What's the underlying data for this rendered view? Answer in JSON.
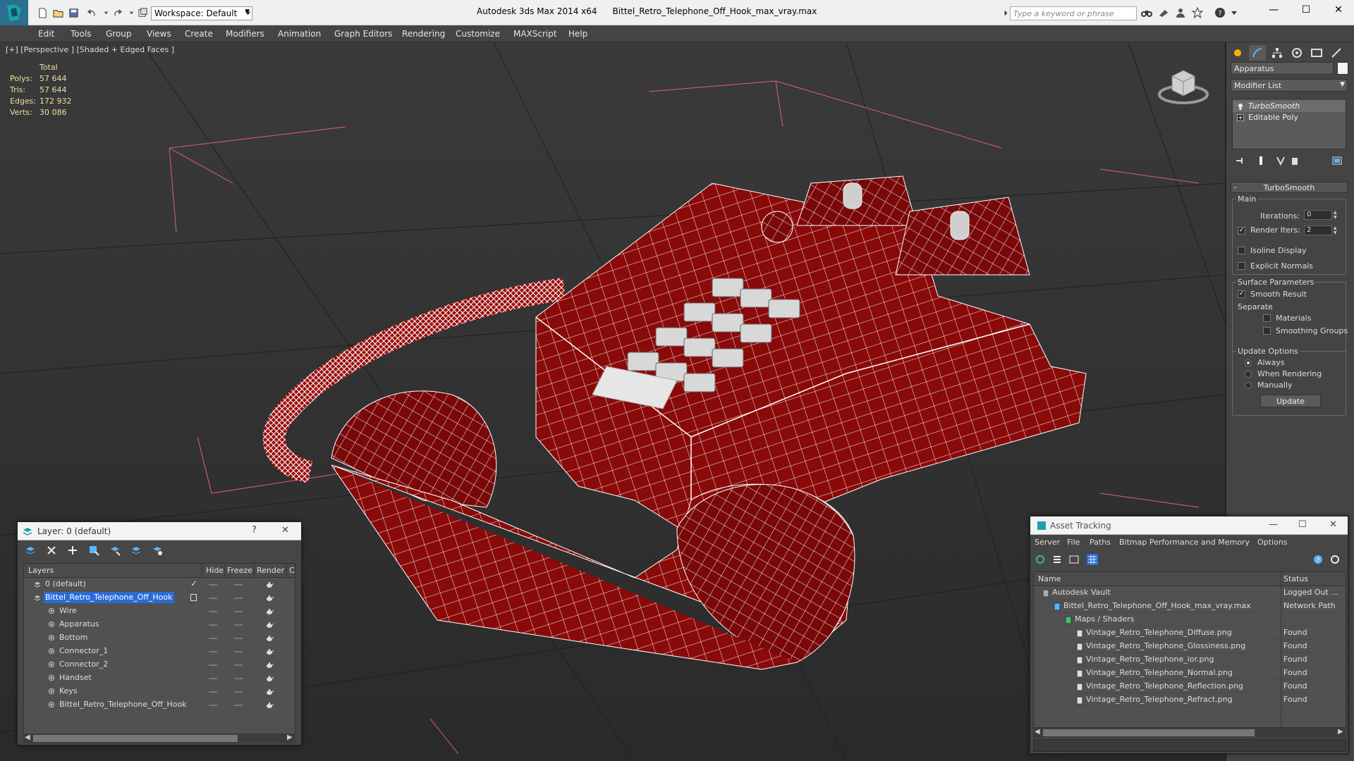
{
  "titlebar": {
    "workspace": "Workspace: Default",
    "app_name": "Autodesk 3ds Max  2014 x64",
    "file_name": "Bittel_Retro_Telephone_Off_Hook_max_vray.max",
    "search_placeholder": "Type a keyword or phrase"
  },
  "menu": [
    "Edit",
    "Tools",
    "Group",
    "Views",
    "Create",
    "Modifiers",
    "Animation",
    "Graph Editors",
    "Rendering",
    "Customize",
    "MAXScript",
    "Help"
  ],
  "viewport": {
    "label": "[+] [Perspective ] [Shaded + Edged Faces ]",
    "stats": {
      "header": "Total",
      "rows": [
        {
          "label": "Polys:",
          "value": "57 644"
        },
        {
          "label": "Tris:",
          "value": "57 644"
        },
        {
          "label": "Edges:",
          "value": "172 932"
        },
        {
          "label": "Verts:",
          "value": "30 086"
        }
      ]
    }
  },
  "command_panel": {
    "object_name": "Apparatus",
    "modifier_list": "Modifier List",
    "stack": [
      "TurboSmooth",
      "Editable Poly"
    ],
    "rollout_title": "TurboSmooth",
    "main_label": "Main",
    "iterations_label": "Iterations:",
    "iterations_value": "0",
    "render_iters_label": "Render Iters:",
    "render_iters_value": "2",
    "isoline_display": "Isoline Display",
    "explicit_normals": "Explicit Normals",
    "surface_params_label": "Surface Parameters",
    "smooth_result": "Smooth Result",
    "separate_label": "Separate",
    "materials": "Materials",
    "smoothing_groups": "Smoothing Groups",
    "update_options_label": "Update Options",
    "always": "Always",
    "when_rendering": "When Rendering",
    "manually": "Manually",
    "update_button": "Update"
  },
  "layer_dialog": {
    "title": "Layer: 0 (default)",
    "help": "?",
    "close": "✕",
    "columns": [
      "Layers",
      "Hide",
      "Freeze",
      "Render",
      "C"
    ],
    "rows": [
      {
        "name": "0 (default)",
        "level": 0
      },
      {
        "name": "Bittel_Retro_Telephone_Off_Hook",
        "level": 0
      },
      {
        "name": "Wire",
        "level": 1
      },
      {
        "name": "Apparatus",
        "level": 1
      },
      {
        "name": "Bottom",
        "level": 1
      },
      {
        "name": "Connector_1",
        "level": 1
      },
      {
        "name": "Connector_2",
        "level": 1
      },
      {
        "name": "Handset",
        "level": 1
      },
      {
        "name": "Keys",
        "level": 1
      },
      {
        "name": "Bittel_Retro_Telephone_Off_Hook",
        "level": 1
      }
    ]
  },
  "asset_dialog": {
    "title": "Asset Tracking",
    "menu": [
      "Server",
      "File",
      "Paths",
      "Bitmap Performance and Memory",
      "Options"
    ],
    "columns": [
      "Name",
      "Status"
    ],
    "rows": [
      {
        "name": "Autodesk Vault",
        "status": "Logged Out ..."
      },
      {
        "name": "Bittel_Retro_Telephone_Off_Hook_max_vray.max",
        "status": "Network Path"
      },
      {
        "name": "Maps / Shaders",
        "status": ""
      },
      {
        "name": "Vintage_Retro_Telephone_Diffuse.png",
        "status": "Found"
      },
      {
        "name": "Vintage_Retro_Telephone_Glossiness.png",
        "status": "Found"
      },
      {
        "name": "Vintage_Retro_Telephone_ior.png",
        "status": "Found"
      },
      {
        "name": "Vintage_Retro_Telephone_Normal.png",
        "status": "Found"
      },
      {
        "name": "Vintage_Retro_Telephone_Reflection.png",
        "status": "Found"
      },
      {
        "name": "Vintage_Retro_Telephone_Refract.png",
        "status": "Found"
      }
    ]
  },
  "colors": {
    "model_red": "#8a0a0a",
    "wire": "#ffffff",
    "selection_blue": "#2b6bd6",
    "stats_yellow": "#e8e0a0"
  }
}
